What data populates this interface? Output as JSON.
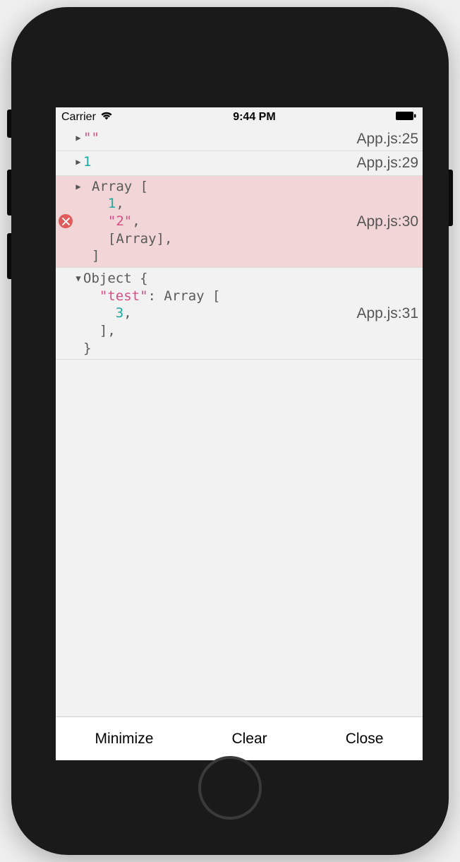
{
  "status_bar": {
    "carrier": "Carrier",
    "time": "9:44 PM"
  },
  "logs": [
    {
      "expanded": false,
      "level": "log",
      "source": "App.js:25",
      "content": {
        "type": "string",
        "value": "\"\""
      }
    },
    {
      "expanded": false,
      "level": "log",
      "source": "App.js:29",
      "content": {
        "type": "number",
        "value": "1"
      }
    },
    {
      "expanded": false,
      "level": "error",
      "source": "App.js:30",
      "content": {
        "type": "array",
        "prefix": "Array [",
        "items": [
          {
            "type": "number",
            "value": "1",
            "comma": ","
          },
          {
            "type": "string",
            "value": "\"2\"",
            "comma": ","
          },
          {
            "type": "raw",
            "value": "[Array]",
            "comma": ","
          }
        ],
        "suffix": "]"
      }
    },
    {
      "expanded": true,
      "level": "log",
      "source": "App.js:31",
      "content": {
        "type": "object",
        "prefix": "Object {",
        "entries": [
          {
            "key": "\"test\"",
            "sep": ": ",
            "value_prefix": "Array [",
            "items": [
              {
                "type": "number",
                "value": "3",
                "comma": ","
              }
            ],
            "value_suffix": "],"
          }
        ],
        "suffix": "}"
      }
    }
  ],
  "bottom_bar": {
    "minimize": "Minimize",
    "clear": "Clear",
    "close": "Close"
  }
}
